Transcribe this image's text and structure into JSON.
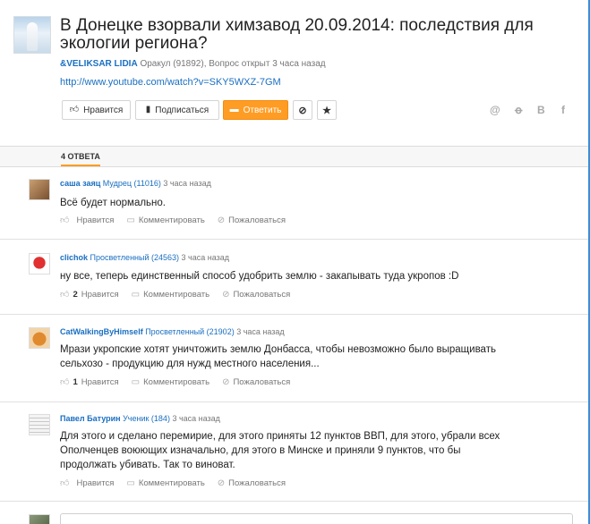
{
  "question": {
    "title": "В Донецке взорвали химзавод 20.09.2014: последствия для экологии региона?",
    "author": "&VELIKSAR LIDIA",
    "author_meta": " Оракул (91892), Вопрос открыт 3 часа назад",
    "link": "http://www.youtube.com/watch?v=SKY5WXZ-7GM",
    "buttons": {
      "like": "Нравится",
      "subscribe": "Подписаться",
      "answer": "Ответить",
      "block_icon": "⊘",
      "star_icon": "★"
    },
    "share_icons": [
      "@",
      "ok-icon",
      "vk-icon",
      "fb-icon"
    ]
  },
  "answers_header": {
    "tab": "4 ОТВЕТА"
  },
  "answers": [
    {
      "name": "саша заяц",
      "rank": " Мудрец (11016)",
      "time": " 3 часа назад",
      "text": "Всё будет нормально.",
      "likes": "",
      "like_label": "Нравится",
      "comment_label": "Комментировать",
      "report_label": "Пожаловаться"
    },
    {
      "name": "clichok",
      "rank": " Просветленный (24563)",
      "time": " 3 часа назад",
      "text": "ну все, теперь единственный способ удобрить землю - закапывать туда укропов :D",
      "likes": "2",
      "like_label": "Нравится",
      "comment_label": "Комментировать",
      "report_label": "Пожаловаться"
    },
    {
      "name": "CatWalkingByHimself",
      "rank": " Просветленный (21902)",
      "time": " 3 часа назад",
      "text": "Мрази укропские хотят уничтожить землю Донбасса, чтобы невозможно было выращивать сельхозо - продукцию для нужд местного населения...",
      "likes": "1",
      "like_label": "Нравится",
      "comment_label": "Комментировать",
      "report_label": "Пожаловаться"
    },
    {
      "name": "Павел Батурин",
      "rank": " Ученик (184)",
      "time": " 3 часа назад",
      "text": "Для этого и сделано перемирие, для этого приняты 12 пунктов ВВП, для этого, убрали всех Ополченцев воюющих изначально, для этого в Минске и приняли 9 пунктов, что бы продолжать убивать. Так то виноват.",
      "likes": "",
      "like_label": "Нравится",
      "comment_label": "Комментировать",
      "report_label": "Пожаловаться"
    }
  ],
  "colors": {
    "accent": "#ff9c24",
    "link": "#1a6fc2"
  }
}
